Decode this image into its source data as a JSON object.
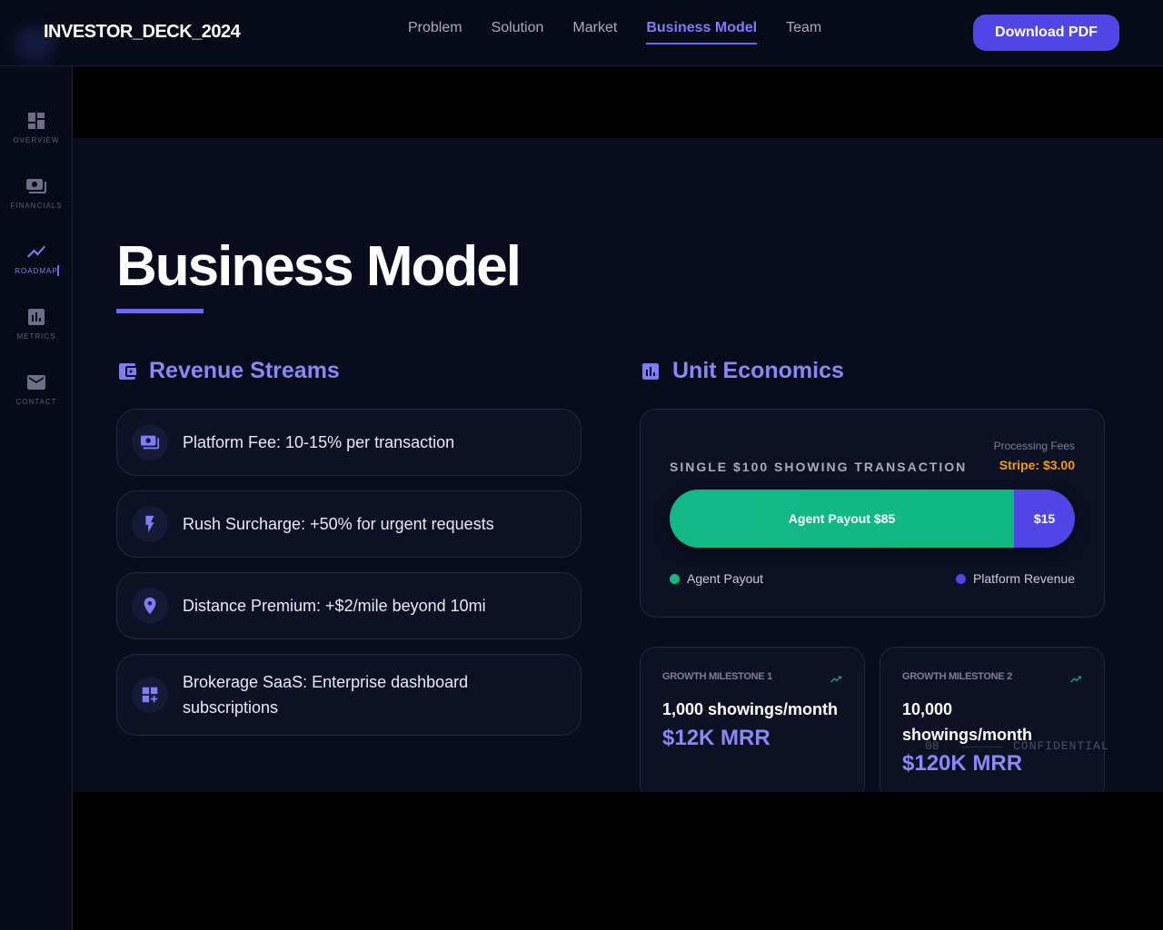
{
  "header": {
    "brand": "INVESTOR_DECK_2024",
    "nav": [
      {
        "label": "Problem",
        "active": false
      },
      {
        "label": "Solution",
        "active": false
      },
      {
        "label": "Market",
        "active": false
      },
      {
        "label": "Business Model",
        "active": true
      },
      {
        "label": "Team",
        "active": false
      }
    ],
    "download_label": "Download PDF"
  },
  "sidebar": {
    "items": [
      {
        "label": "OVERVIEW",
        "icon": "dashboard-icon",
        "active": false
      },
      {
        "label": "FINANCIALS",
        "icon": "money-icon",
        "active": false
      },
      {
        "label": "ROADMAP",
        "icon": "trend-line-icon",
        "active": true
      },
      {
        "label": "METRICS",
        "icon": "bar-chart-icon",
        "active": false
      },
      {
        "label": "CONTACT",
        "icon": "mail-icon",
        "active": false
      }
    ]
  },
  "slide": {
    "title": "Business Model",
    "revenue": {
      "title": "Revenue Streams",
      "items": [
        {
          "text": "Platform Fee: 10-15% per transaction",
          "icon": "money-icon"
        },
        {
          "text": "Rush Surcharge: +50% for urgent requests",
          "icon": "bolt-icon"
        },
        {
          "text": "Distance Premium: +$2/mile beyond 10mi",
          "icon": "location-pin-icon"
        },
        {
          "text": "Brokerage SaaS: Enterprise dashboard subscriptions",
          "icon": "add-grid-icon"
        }
      ]
    },
    "unit_economics": {
      "title": "Unit Economics",
      "heading": "SINGLE $100 SHOWING TRANSACTION",
      "fees_label": "Processing Fees",
      "fees_value": "Stripe: $3.00",
      "agent_bar_label": "Agent Payout $85",
      "platform_bar_label": "$15",
      "agent_share": 85,
      "platform_share": 15,
      "legend_agent": "Agent Payout",
      "legend_platform": "Platform Revenue",
      "colors": {
        "agent": "#10b981",
        "platform": "#4f46e5",
        "fees": "#f59e0b"
      }
    },
    "milestones": [
      {
        "label": "GROWTH MILESTONE 1",
        "value": "1,000 showings/month",
        "mrr": "$12K MRR"
      },
      {
        "label": "GROWTH MILESTONE 2",
        "value": "10,000 showings/month",
        "mrr": "$120K MRR"
      }
    ],
    "footer": {
      "page": "08",
      "tag": "CONFIDENTIAL"
    }
  },
  "colors": {
    "accent": "#6c68f0",
    "background": "#080c1d"
  }
}
